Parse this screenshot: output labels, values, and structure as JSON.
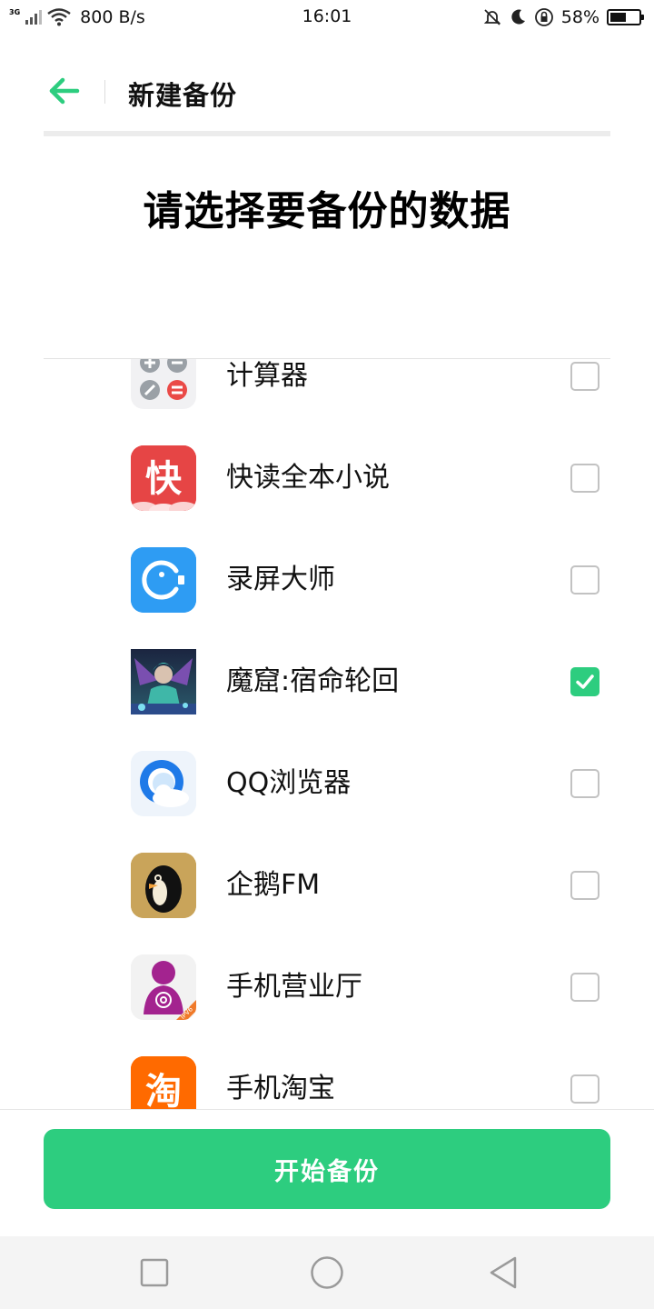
{
  "status_bar": {
    "network": "3G",
    "speed": "800 B/s",
    "time": "16:01",
    "battery_percent": "58%",
    "battery_level": 0.58,
    "icons": [
      "signal-icon",
      "wifi-icon",
      "bell-muted-icon",
      "moon-icon",
      "rotation-lock-icon",
      "battery-icon"
    ]
  },
  "header": {
    "back_icon": "arrow-left-icon",
    "title": "新建备份"
  },
  "heading": "请选择要备份的数据",
  "apps": [
    {
      "name": "计算器",
      "icon": "calculator-icon",
      "checked": false
    },
    {
      "name": "快读全本小说",
      "icon": "kuaidu-novel-icon",
      "checked": false
    },
    {
      "name": "录屏大师",
      "icon": "screen-recorder-icon",
      "checked": false
    },
    {
      "name": "魔窟:宿命轮回",
      "icon": "moku-game-icon",
      "checked": true
    },
    {
      "name": "QQ浏览器",
      "icon": "qq-browser-icon",
      "checked": false
    },
    {
      "name": "企鹅FM",
      "icon": "qie-fm-icon",
      "checked": false
    },
    {
      "name": "手机营业厅",
      "icon": "mobile-service-hall-icon",
      "checked": false
    },
    {
      "name": "手机淘宝",
      "icon": "taobao-icon",
      "checked": false
    }
  ],
  "app_icon_texts": {
    "kuaidu": "快",
    "taobao": "淘",
    "ipv6_badge": "IPV6"
  },
  "primary_button": "开始备份",
  "nav": {
    "recent_icon": "square-recent-icon",
    "home_icon": "circle-home-icon",
    "back_icon": "triangle-back-icon"
  },
  "colors": {
    "accent": "#2dcd7f",
    "checkbox_border": "#c2c2c2"
  }
}
